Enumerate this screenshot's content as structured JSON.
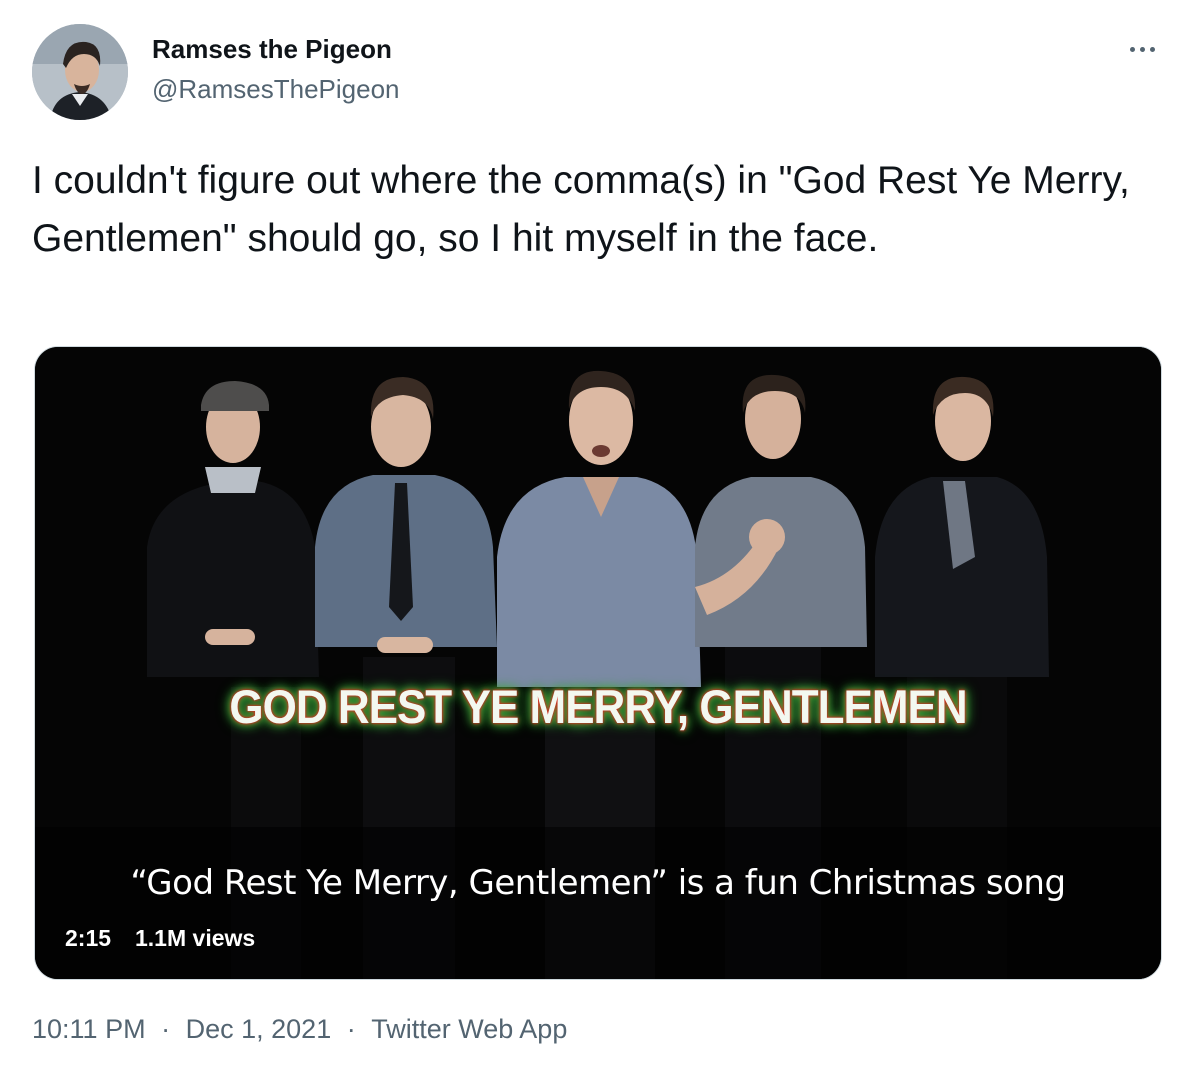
{
  "author": {
    "name": "Ramses the Pigeon",
    "handle": "@RamsesThePigeon"
  },
  "more_icon": "more-horizontal-icon",
  "tweet": {
    "text": "I couldn't figure out where the comma(s) in \"God Rest Ye Merry, Gentlemen\" should go, so I hit myself in the face."
  },
  "video": {
    "title_overlay": "GOD REST YE MERRY, GENTLEMEN",
    "caption": "“God Rest Ye Merry, Gentlemen” is a fun Christmas song",
    "duration": "2:15",
    "views": "1.1M views"
  },
  "meta": {
    "time": "10:11 PM",
    "separator": "·",
    "date": "Dec 1, 2021",
    "source": "Twitter Web App"
  },
  "colors": {
    "text_primary": "#0f1419",
    "text_secondary": "#536471",
    "media_border": "#cfd9de"
  }
}
